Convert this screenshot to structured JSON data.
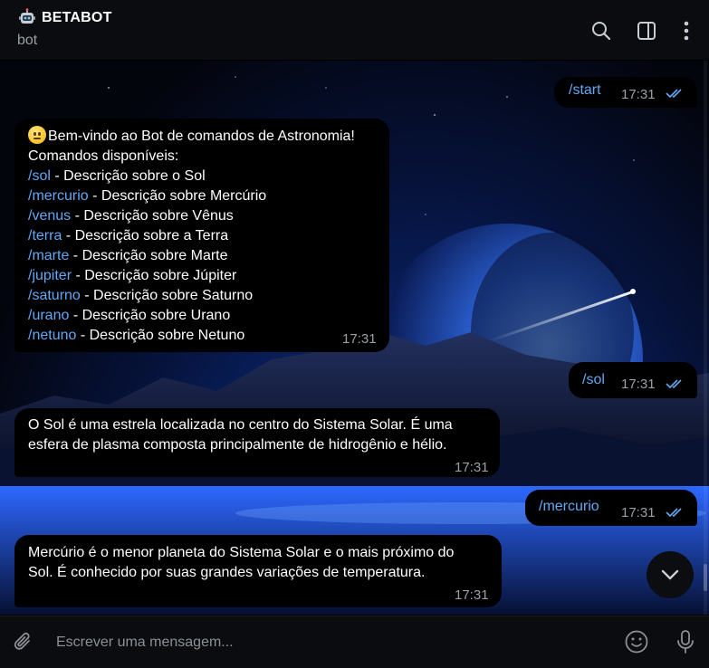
{
  "header": {
    "title": "BETABOT",
    "subtitle": "bot",
    "icons": [
      "robot-avatar-icon",
      "search-icon",
      "side-panel-icon",
      "more-vertical-icon"
    ]
  },
  "messages": [
    {
      "direction": "outgoing",
      "text": "/start",
      "time": "17:31",
      "status": "read"
    },
    {
      "direction": "incoming",
      "time": "17:31",
      "lines": [
        {
          "cmd": "",
          "text": "Bem-vindo ao Bot de comandos de Astronomia!",
          "emoji": "neutral-face-emoji"
        },
        {
          "cmd": "",
          "text": "Comandos disponíveis:"
        },
        {
          "cmd": "/sol",
          "text": " - Descrição sobre o Sol"
        },
        {
          "cmd": "/mercurio",
          "text": " - Descrição sobre Mercúrio"
        },
        {
          "cmd": "/venus",
          "text": " - Descrição sobre Vênus"
        },
        {
          "cmd": "/terra",
          "text": " - Descrição sobre a Terra"
        },
        {
          "cmd": "/marte",
          "text": " - Descrição sobre Marte"
        },
        {
          "cmd": "/jupiter",
          "text": " - Descrição sobre Júpiter"
        },
        {
          "cmd": "/saturno",
          "text": " - Descrição sobre Saturno"
        },
        {
          "cmd": "/urano",
          "text": " - Descrição sobre Urano"
        },
        {
          "cmd": "/netuno",
          "text": " - Descrição sobre Netuno"
        }
      ]
    },
    {
      "direction": "outgoing",
      "text": "/sol",
      "time": "17:31",
      "status": "read"
    },
    {
      "direction": "incoming",
      "time": "17:31",
      "lines": [
        {
          "text": "O Sol é uma estrela localizada no centro do Sistema Solar. É uma"
        },
        {
          "text": "esfera de plasma composta principalmente de hidrogênio e hélio."
        }
      ]
    },
    {
      "direction": "outgoing",
      "text": "/mercurio",
      "time": "17:31",
      "status": "read"
    },
    {
      "direction": "incoming",
      "time": "17:31",
      "lines": [
        {
          "text": "Mercúrio é o menor planeta do Sistema Solar e o mais próximo do"
        },
        {
          "text": "Sol. É conhecido por suas grandes variações de temperatura."
        }
      ]
    }
  ],
  "composer": {
    "placeholder": "Escrever uma mensagem...",
    "value": ""
  },
  "colors": {
    "command_link": "#62a8f5",
    "bubble_bg": "#000000",
    "header_bg": "#0b0c0f",
    "timestamp": "#9aa0a6",
    "check_read": "#62a8f5"
  }
}
